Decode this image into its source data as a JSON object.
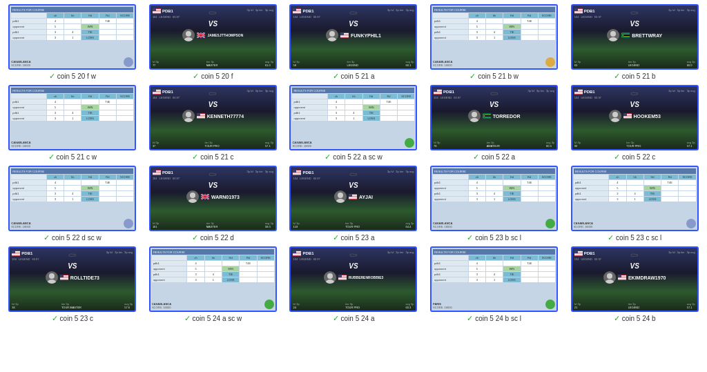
{
  "cards": [
    {
      "type": "scorecard",
      "caption": "coin 5 20 f w",
      "location": "CASABLANCA",
      "hasIcon": true,
      "iconColor": "#8899cc"
    },
    {
      "type": "vs",
      "caption": "coin 5 20 f",
      "opponent": "JAMESJTTHOMPSON",
      "opponentFlag": "gb",
      "tier": "3p",
      "tierLabel": "MASTER"
    },
    {
      "type": "vs",
      "caption": "coin 5 21 a",
      "opponent": "FUNKYPHIL1",
      "opponentFlag": "us",
      "tier": "3p",
      "tierLabel": "LEGEND"
    },
    {
      "type": "scorecard",
      "caption": "coin 5 21 b w",
      "location": "CASABLANCA",
      "hasIcon": true,
      "iconColor": "#ddaa44"
    },
    {
      "type": "vs",
      "caption": "coin 5 21 b",
      "opponent": "BRETTWRAY",
      "opponentFlag": "za",
      "tier": "3p",
      "tierLabel": "LEGEND"
    },
    {
      "type": "scorecard",
      "caption": "coin 5 21 c w",
      "location": "CASABLANCA",
      "hasIcon": false
    },
    {
      "type": "vs",
      "caption": "coin 5 21 c",
      "opponent": "KENNETH77774",
      "opponentFlag": "us",
      "tier": "3p",
      "tierLabel": "TOUR PRO"
    },
    {
      "type": "scorecard2",
      "caption": "coin 5 22 a sc w",
      "location": "CASABLANCA",
      "hasIcon": true,
      "iconColor": "#44aa44"
    },
    {
      "type": "vs",
      "caption": "coin 5 22 a",
      "opponent": "TORREDOR",
      "opponentFlag": "za",
      "tier": "3p",
      "tierLabel": "AMATEUR"
    },
    {
      "type": "vs",
      "caption": "coin 5 22 c",
      "opponent": "HOOKEM53",
      "opponentFlag": "us",
      "tier": "3p",
      "tierLabel": "TOUR PRO"
    },
    {
      "type": "scorecard",
      "caption": "coin 5 22 d sc w",
      "location": "CASABLANCA",
      "hasIcon": true,
      "iconColor": "#8899cc"
    },
    {
      "type": "vs",
      "caption": "coin 5 22 d",
      "opponent": "WARN01973",
      "opponentFlag": "gb",
      "tier": "3p",
      "tierLabel": "MASTER"
    },
    {
      "type": "vs",
      "caption": "coin 5 23 a",
      "opponent": "AYJAI",
      "opponentFlag": "us",
      "tier": "3p",
      "tierLabel": "TOUR PRO"
    },
    {
      "type": "scorecard3",
      "caption": "coin 5 23 b sc l",
      "location": "CASABLANCA",
      "hasIcon": true,
      "iconColor": "#44aa44"
    },
    {
      "type": "scorecard4",
      "caption": "coin 5 23 c sc l",
      "location": "CASABLANCA",
      "hasIcon": true,
      "iconColor": "#8899cc"
    },
    {
      "type": "vs",
      "caption": "coin 5 23 c",
      "opponent": "ROLLTIDE73",
      "opponentFlag": "us",
      "tier": "3p",
      "tierLabel": "TOUR MASTER"
    },
    {
      "type": "scorecard5",
      "caption": "coin 5 24 a sc w",
      "location": "CASABLANCA",
      "hasIcon": true,
      "iconColor": "#44aa44"
    },
    {
      "type": "vs",
      "caption": "coin 5 24 a",
      "opponent": "RUBBERENROBBIE3",
      "opponentFlag": "us",
      "tier": "3p",
      "tierLabel": "TOUR PRO"
    },
    {
      "type": "scorecard6",
      "caption": "coin 5 24 b sc l",
      "location": "PARIS",
      "hasIcon": true,
      "iconColor": "#44aa44"
    },
    {
      "type": "vs",
      "caption": "coin 5 24 b",
      "opponent": "EKIMDRAW1970",
      "opponentFlag": "us",
      "tier": "3p",
      "tierLabel": "LEGEND"
    }
  ],
  "checkmark": "✓"
}
